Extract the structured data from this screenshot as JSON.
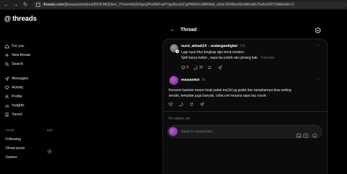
{
  "browser": {
    "url_host": "threads.com",
    "url_path": "/@masyamtot/post/DOIUMQOkm_3?xmt=AQGOgnQPw0M0-wP7lgnBzsZsCgPWDhXcBMSbA_xDak7ER8hcADaN0miEUTw8xZWY1tMAlokE=1"
  },
  "sidebar": {
    "logo_text": "threads",
    "nav": [
      {
        "label": "For you",
        "icon": "home-icon"
      },
      {
        "label": "New thread",
        "icon": "plus-icon"
      },
      {
        "label": "Search",
        "icon": "search-icon"
      },
      {
        "label": "Messages",
        "icon": "send-icon"
      },
      {
        "label": "Activity",
        "icon": "heart-icon"
      },
      {
        "label": "Profile",
        "icon": "person-icon"
      },
      {
        "label": "Insights",
        "icon": "chart-icon"
      },
      {
        "label": "Saved",
        "icon": "bookmark-icon"
      }
    ],
    "feeds_heading": "Feeds",
    "feeds_edit": "Edit",
    "feeds": [
      {
        "label": "Following"
      },
      {
        "label": "Ghost posts"
      },
      {
        "label": "Games"
      }
    ]
  },
  "header": {
    "title": "Thread"
  },
  "post1": {
    "username": "nurul_alimah14",
    "separator": "›",
    "topic": "undangandigital",
    "time": "21h",
    "line1": "Lagi nyari fitur lengkap dgn tema modern",
    "line2": "Spill karya kalian , sapa tau jodoh aku pinang kak.",
    "translate": "Translate",
    "likes": "5",
    "replies": "10",
    "reposts": "",
    "shares": ""
  },
  "post2": {
    "username": "masyamtot",
    "time": "3h",
    "line1": "Kemarin bantuin temen buat pakai me(3d yg gratis dan tampilannya bisa setting",
    "line2": "sendiri, template juga banyak, coba cek keuana sapa tau cocok"
  },
  "thread": {
    "no_replies": "No replies yet",
    "reply_placeholder": "Reply to masyamtot..."
  },
  "colors": {
    "background": "#000000",
    "panel": "#0b0b0b",
    "avatar_purple": "#a03cc0"
  }
}
